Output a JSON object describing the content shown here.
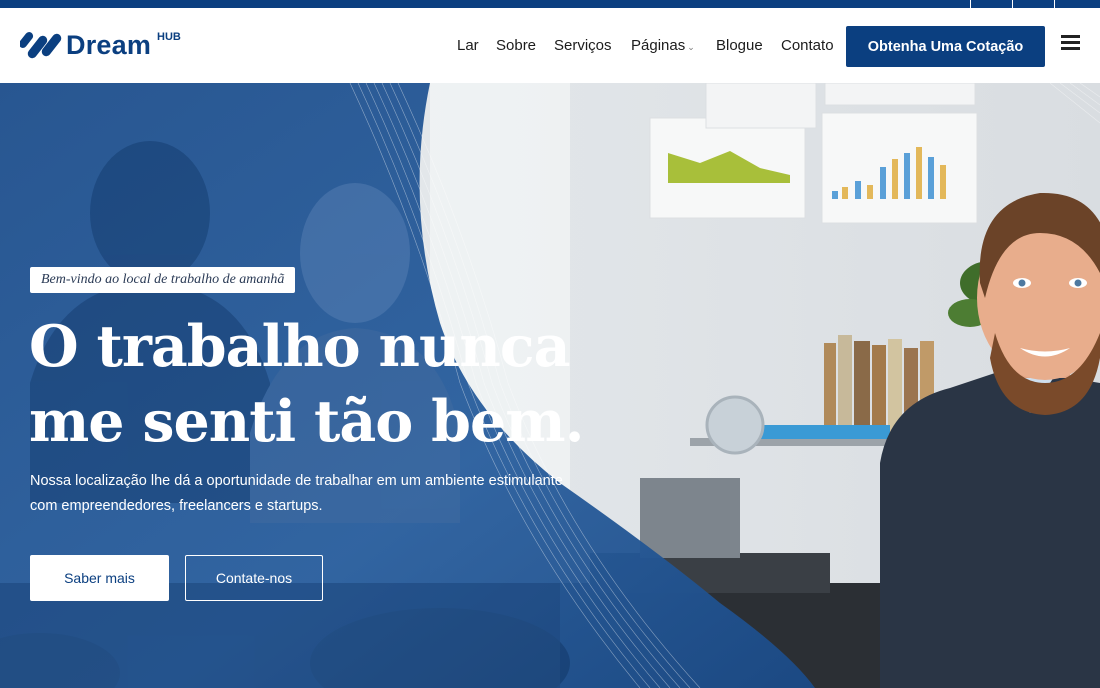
{
  "brand": {
    "name": "Dream",
    "suffix": "HUB",
    "primary_color": "#0b3f80",
    "logo_icon": "dreamhub-logo-mark"
  },
  "nav": {
    "items": [
      {
        "label": "Lar"
      },
      {
        "label": "Sobre"
      },
      {
        "label": "Serviços"
      },
      {
        "label": "Páginas",
        "has_dropdown": true
      },
      {
        "label": "Blogue"
      },
      {
        "label": "Contato"
      }
    ],
    "dropdown_icon": "chevron-down-icon",
    "cta_label": "Obtenha Uma Cotação",
    "menu_icon": "hamburger-menu-icon"
  },
  "hero": {
    "tagline": "Bem-vindo ao local de trabalho de amanhã",
    "headline_line1": "O trabalho nunca",
    "headline_line2": "me senti tão bem.",
    "subtext_line1": "Nossa localização lhe dá a oportunidade de trabalhar em um ambiente estimulante",
    "subtext_line2": "com empreendedores, freelancers e startups.",
    "primary_button": "Saber mais",
    "secondary_button": "Contate-nos"
  }
}
